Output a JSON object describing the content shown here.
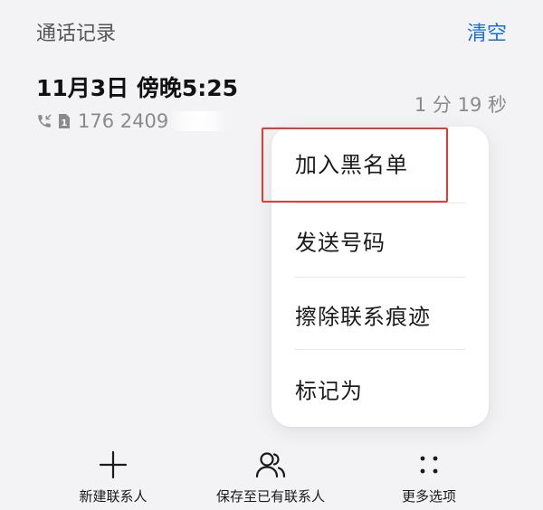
{
  "header": {
    "title": "通话记录",
    "clear_label": "清空"
  },
  "record": {
    "date_time": "11月3日 傍晚5:25",
    "call_icon": "incoming-call-icon",
    "sim_icon": "sim-1-icon",
    "number_visible": "176 2409",
    "duration": "1 分 19 秒"
  },
  "context_menu": {
    "items": [
      {
        "label": "加入黑名单"
      },
      {
        "label": "发送号码"
      },
      {
        "label": "擦除联系痕迹"
      },
      {
        "label": "标记为"
      }
    ],
    "highlight_color": "#e53935"
  },
  "bottom_actions": [
    {
      "label": "新建联系人",
      "icon": "plus-icon"
    },
    {
      "label": "保存至已有联系人",
      "icon": "contacts-icon"
    },
    {
      "label": "更多选项",
      "icon": "more-dots-icon"
    }
  ],
  "colors": {
    "accent": "#1a6fd6",
    "background": "#f3f3f5"
  }
}
